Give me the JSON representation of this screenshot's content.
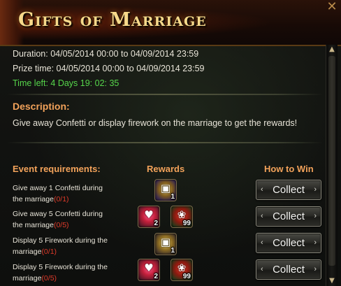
{
  "header": {
    "title": "Gifts of Marriage",
    "close_glyph": "✕"
  },
  "info": {
    "duration": "Duration: 04/05/2014 00:00 to 04/09/2014 23:59",
    "prize_time": "Prize time: 04/05/2014 00:00 to 04/09/2014 23:59",
    "time_left": "Time left: 4 Days  19: 02: 35"
  },
  "description": {
    "heading": "Description:",
    "text": "Give away Confetti or display firework on the marriage to get the rewards!"
  },
  "columns": {
    "requirements": "Event requirements:",
    "rewards": "Rewards",
    "how_to_win": "How to Win"
  },
  "rows": [
    {
      "line1": "Give away 1 Confetti during",
      "line2": "the marriage",
      "progress": "(0/1)",
      "rewards": [
        {
          "icon": "treasure-chest-icon",
          "count": "1"
        }
      ],
      "button": "Collect"
    },
    {
      "line1": "Give away 5 Confetti during",
      "line2": "the marriage",
      "progress": "(0/5)",
      "rewards": [
        {
          "icon": "heart-icon",
          "count": "2"
        },
        {
          "icon": "roses-icon",
          "count": "99"
        }
      ],
      "button": "Collect"
    },
    {
      "line1": "Display 5 Firework during the",
      "line2": "marriage",
      "progress": "(0/1)",
      "rewards": [
        {
          "icon": "treasure-chest-icon",
          "count": "1"
        }
      ],
      "button": "Collect"
    },
    {
      "line1": "Display 5 Firework during the",
      "line2": "marriage",
      "progress": "(0/5)",
      "rewards": [
        {
          "icon": "heart-icon",
          "count": "2"
        },
        {
          "icon": "roses-icon",
          "count": "99"
        }
      ],
      "button": "Collect"
    }
  ],
  "colors": {
    "accent": "#f2a25a",
    "time_left": "#56d64b",
    "progress": "#e03a2a",
    "title": "#f7d98a"
  }
}
